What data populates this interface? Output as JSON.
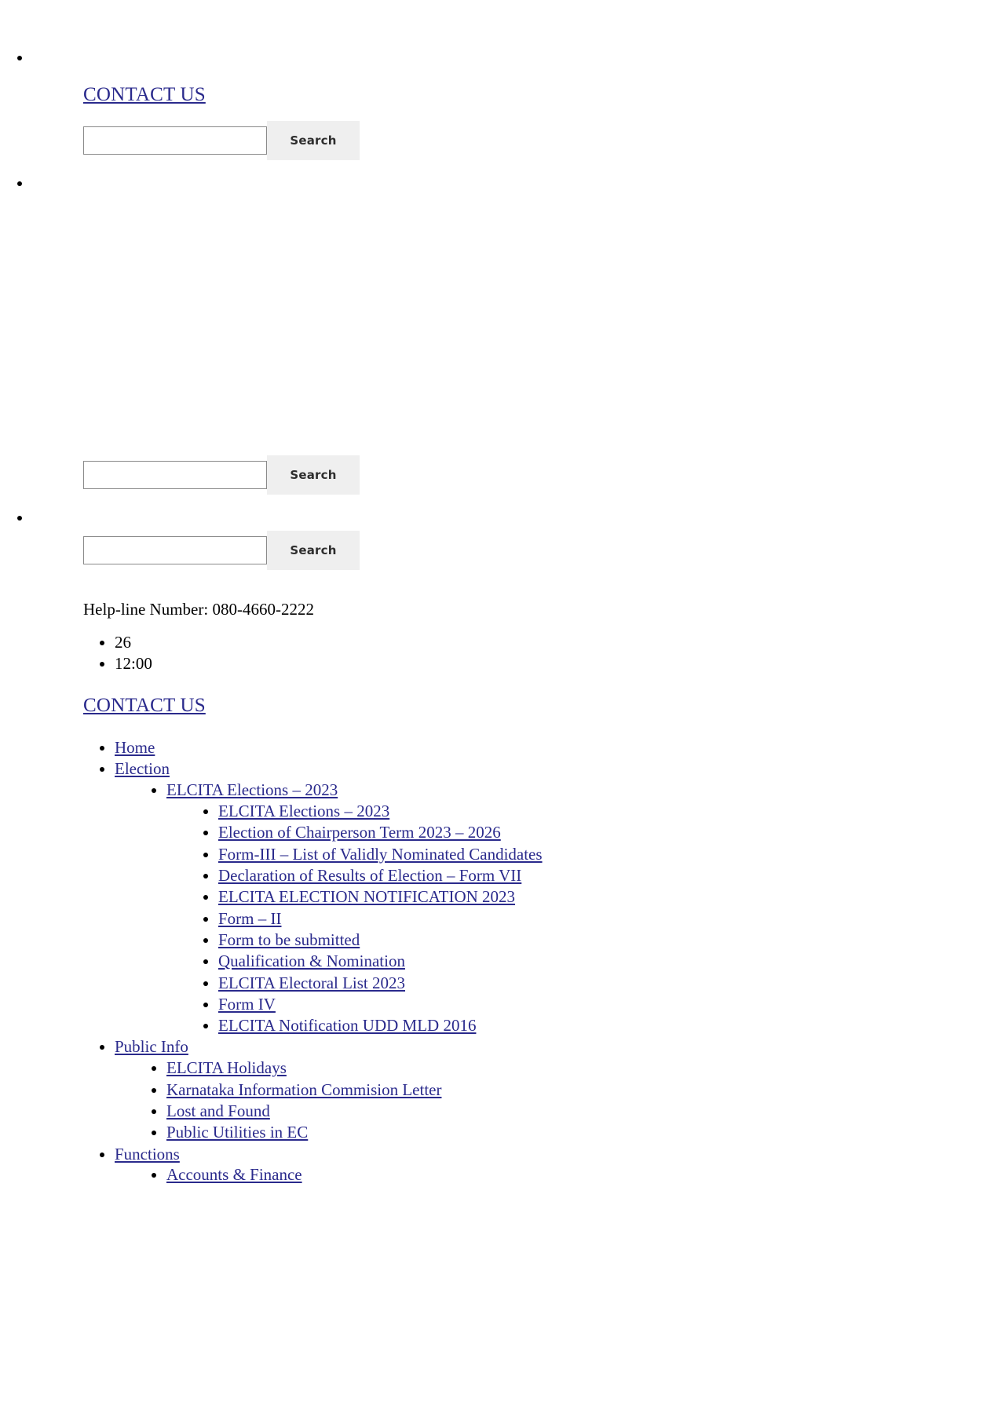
{
  "top": {
    "bullet_placeholder": "",
    "contact_label": "CONTACT US "
  },
  "search": {
    "button_label": "Search",
    "value": "",
    "placeholder": ""
  },
  "helpline": {
    "text": "Help-line Number: 080-4660-2222"
  },
  "ticker": {
    "items": [
      "26",
      "12:00"
    ]
  },
  "contact_secondary": {
    "label": "CONTACT US "
  },
  "nav": {
    "items": [
      {
        "label": "Home",
        "children": []
      },
      {
        "label": "Election",
        "children": [
          {
            "label": "ELCITA Elections – 2023",
            "children": [
              {
                "label": "ELCITA Elections – 2023"
              },
              {
                "label": "Election of Chairperson Term 2023 – 2026"
              },
              {
                "label": "Form-III – List of Validly Nominated Candidates"
              },
              {
                "label": "Declaration of Results of Election – Form VII"
              },
              {
                "label": "ELCITA ELECTION NOTIFICATION 2023"
              },
              {
                "label": "Form – II"
              },
              {
                "label": "Form to be submitted"
              },
              {
                "label": "Qualification & Nomination"
              },
              {
                "label": "ELCITA Electoral List 2023"
              },
              {
                "label": "Form IV"
              },
              {
                "label": "ELCITA Notification UDD MLD 2016"
              }
            ]
          }
        ]
      },
      {
        "label": "Public Info",
        "children": [
          {
            "label": "ELCITA Holidays"
          },
          {
            "label": "Karnataka Information Commision Letter"
          },
          {
            "label": "Lost and Found"
          },
          {
            "label": "Public Utilities in EC"
          }
        ]
      },
      {
        "label": "Functions",
        "children": [
          {
            "label": "Accounts & Finance"
          }
        ]
      }
    ]
  },
  "colors": {
    "link": "#2a2a8c",
    "button_bg": "#efefef",
    "input_border": "#8a8a8a",
    "page_bg": "#ffffff"
  }
}
